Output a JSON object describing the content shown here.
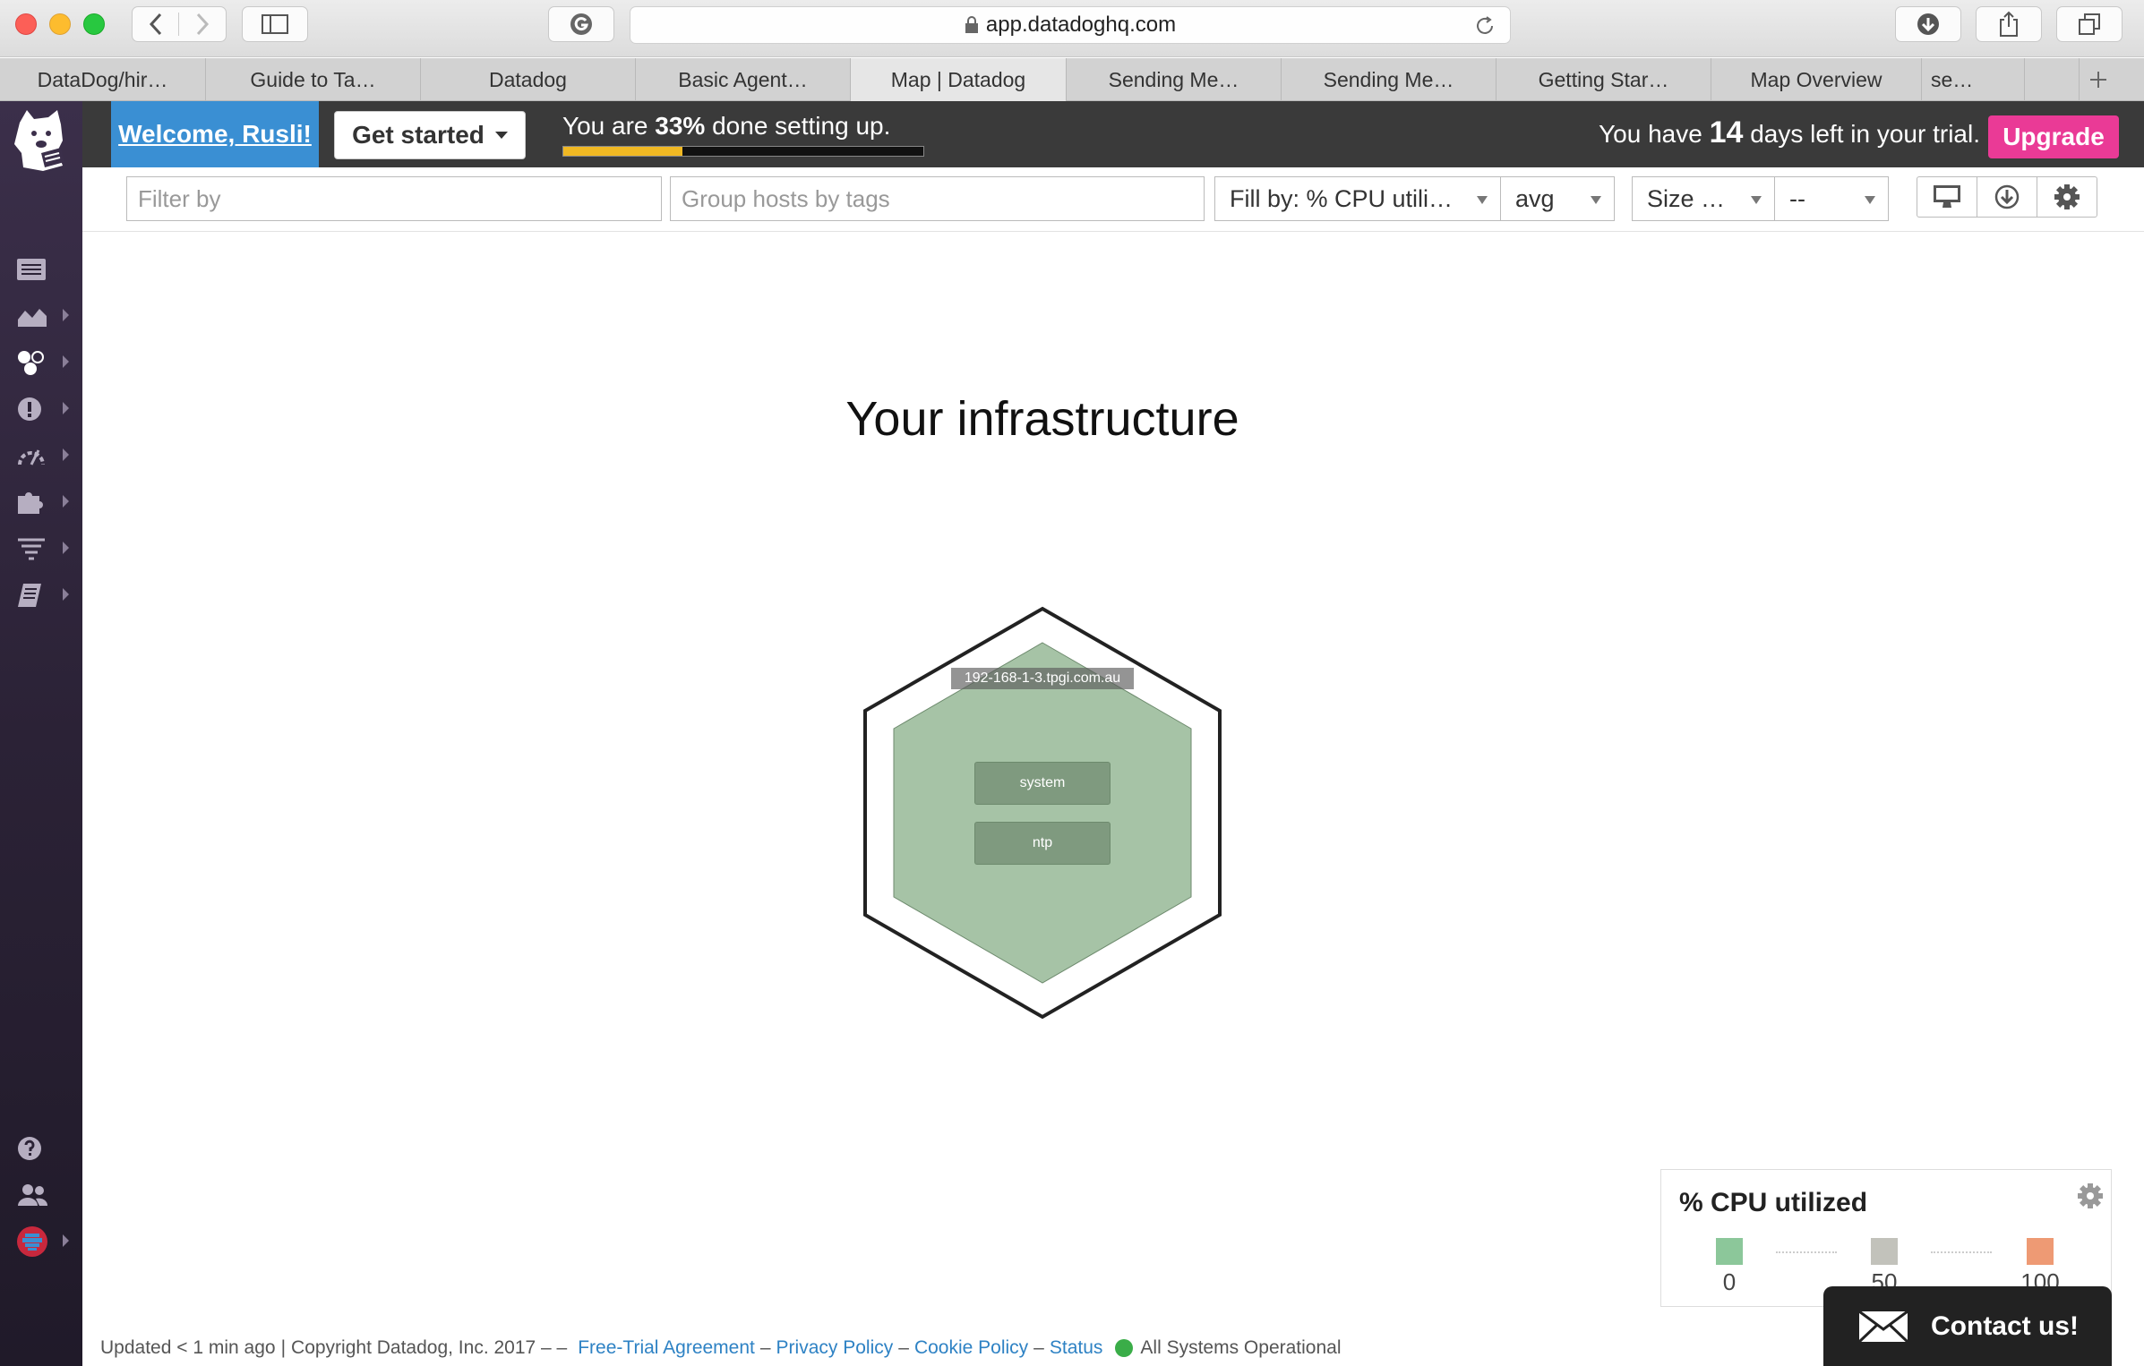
{
  "browser": {
    "url": "app.datadoghq.com",
    "tabs": [
      {
        "label": "DataDog/hir…",
        "active": false
      },
      {
        "label": "Guide to Ta…",
        "active": false
      },
      {
        "label": "Datadog",
        "active": false
      },
      {
        "label": "Basic Agent…",
        "active": false
      },
      {
        "label": "Map | Datadog",
        "active": true
      },
      {
        "label": "Sending Me…",
        "active": false
      },
      {
        "label": "Sending Me…",
        "active": false
      },
      {
        "label": "Getting Star…",
        "active": false
      },
      {
        "label": "Map Overview",
        "active": false
      },
      {
        "label": "se…",
        "active": false
      }
    ]
  },
  "header": {
    "welcome": "Welcome, Rusli!",
    "get_started": "Get started",
    "progress_prefix": "You are ",
    "progress_percent": "33%",
    "progress_suffix": " done setting up.",
    "progress_value": 0.33,
    "trial_prefix": "You have ",
    "trial_days": "14",
    "trial_suffix": " days left in your trial.",
    "upgrade": "Upgrade"
  },
  "toolbar": {
    "filter_placeholder": "Filter by",
    "group_placeholder": "Group hosts by tags",
    "fill_by": "Fill by: % CPU utili…",
    "aggregation": "avg",
    "size_by": "Size …",
    "size_agg": "--"
  },
  "main": {
    "title": "Your infrastructure",
    "host": {
      "name": "192-168-1-3.tpgi.com.au",
      "tags": [
        "system",
        "ntp"
      ],
      "fill_color": "#a6c3a6"
    }
  },
  "legend": {
    "title": "% CPU utilized",
    "stops": [
      {
        "value": "0",
        "color": "#8cc79a"
      },
      {
        "value": "50",
        "color": "#c2c2bb"
      },
      {
        "value": "100",
        "color": "#ee9a74"
      }
    ]
  },
  "contact": {
    "label": "Contact us!"
  },
  "footer": {
    "updated": "Updated < 1 min ago",
    "copyright": "Copyright Datadog, Inc. 2017 – –",
    "links": [
      "Free-Trial Agreement",
      "Privacy Policy",
      "Cookie Policy",
      "Status"
    ],
    "status_text": "All Systems Operational"
  },
  "colors": {
    "welcome_bg": "#3a8fd3",
    "upgrade_bg": "#ea3a96",
    "progress_fill": "#f0b823",
    "nav_bg": "#2b2236",
    "status_ok": "#3aad48"
  }
}
